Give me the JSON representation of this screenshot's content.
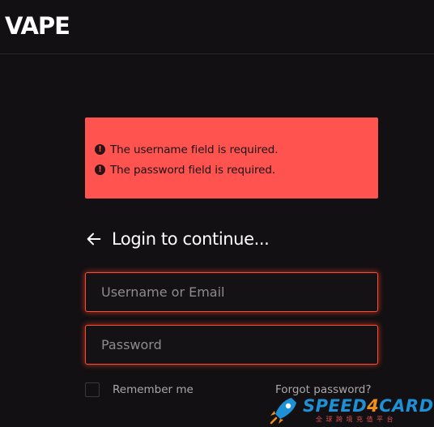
{
  "header": {
    "logo_text": "VAPE"
  },
  "alert": {
    "messages": [
      "The username field is required.",
      "The password field is required."
    ],
    "color": "#ff5350"
  },
  "login": {
    "back_icon": "arrow-left-icon",
    "title": "Login to continue..."
  },
  "form": {
    "username_placeholder": "Username or Email",
    "password_placeholder": "Password",
    "remember_label": "Remember me",
    "forgot_label": "Forgot password?",
    "error_border_color": "#ff4a33"
  },
  "watermark": {
    "brand_main": "SPEED",
    "brand_digit": "4",
    "brand_tail": "CARD",
    "tagline": "全球跨境充值平台",
    "icon": "rocket-icon"
  }
}
